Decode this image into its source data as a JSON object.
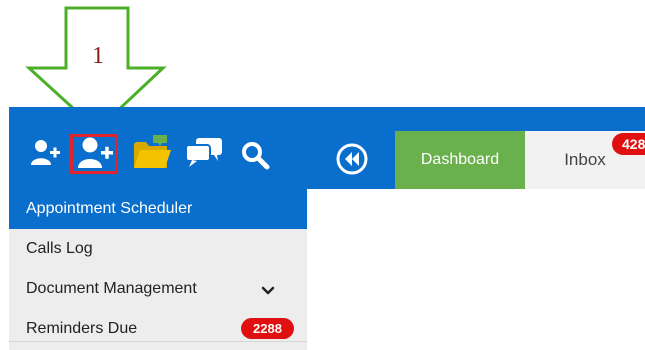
{
  "annotation": {
    "step_number": "1",
    "arrow_color": "#4caf28",
    "highlight_color": "#e0242b"
  },
  "toolbar": {
    "icons": [
      "user-add-icon",
      "user-add-icon",
      "folder-open-icon",
      "chat-bubbles-icon",
      "search-icon"
    ],
    "back_icon": "rewind-circle-icon"
  },
  "tabs": [
    {
      "label": "Dashboard",
      "active": true
    },
    {
      "label": "Inbox",
      "badge": "428"
    }
  ],
  "sidebar": {
    "items": [
      {
        "label": "Appointment Scheduler",
        "active": true
      },
      {
        "label": "Calls Log"
      },
      {
        "label": "Document Management",
        "chevron": "chevron-down-icon"
      },
      {
        "label": "Reminders Due",
        "badge": "2288"
      }
    ]
  },
  "colors": {
    "brand_blue": "#0a6fcc",
    "dashboard_green": "#6ab04c",
    "badge_red": "#e01010",
    "sidebar_bg": "#ededed",
    "folder_yellow": "#f3c300",
    "folder_green": "#6ab04c"
  }
}
